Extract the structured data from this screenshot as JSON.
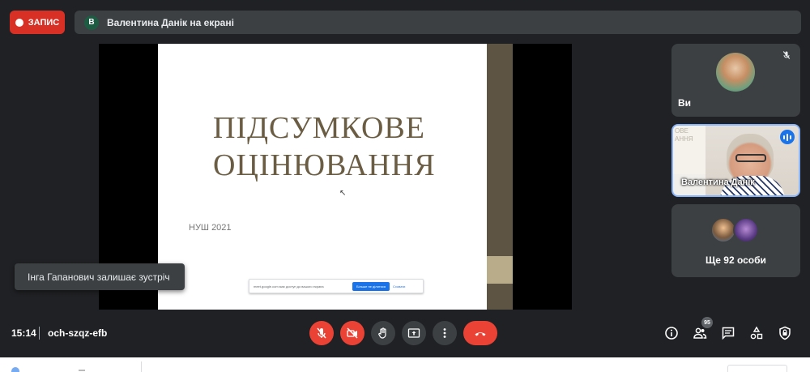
{
  "recording": {
    "label": "ЗАПИС"
  },
  "presenter_bar": {
    "avatar_letter": "В",
    "text": "Валентина Данік на екрані"
  },
  "slide": {
    "title_line1": "ПІДСУМКОВЕ",
    "title_line2": "ОЦІНЮВАННЯ",
    "subtitle": "НУШ 2021"
  },
  "share_bar": {
    "text": "meet.google.com має доступ до вашого екрана",
    "stop_label": "Більше не ділитися",
    "hide_label": "Сховати"
  },
  "toast": {
    "text": "Інга Гапанович залишає зустріч"
  },
  "participants": {
    "you_label": "Ви",
    "presenter_name": "Валентина Данік",
    "presenter_board_text": "ОВЕ\nАННЯ",
    "more_label": "Ще 92 особи"
  },
  "bottom_bar": {
    "time": "15:14",
    "meeting_code": "och-szqz-efb",
    "participant_count": "95"
  },
  "icons": {
    "mic": "mic-off-icon",
    "camera": "camera-off-icon",
    "hand": "raise-hand-icon",
    "present": "present-screen-icon",
    "more": "more-options-icon",
    "end": "end-call-icon",
    "info": "info-icon",
    "people": "people-icon",
    "chat": "chat-icon",
    "activities": "activities-icon",
    "host": "host-controls-icon"
  },
  "colors": {
    "record_red": "#d93025",
    "end_call_red": "#ea4335",
    "active_border": "#8ab4f8",
    "background": "#202124"
  }
}
